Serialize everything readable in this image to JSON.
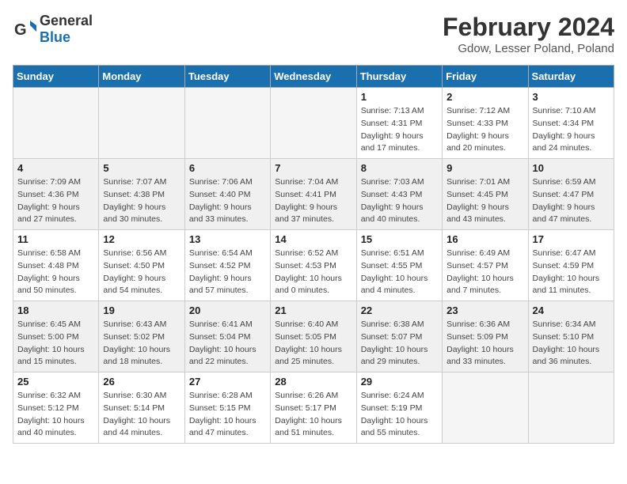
{
  "header": {
    "logo_line1": "General",
    "logo_line2": "Blue",
    "month_title": "February 2024",
    "location": "Gdow, Lesser Poland, Poland"
  },
  "days_of_week": [
    "Sunday",
    "Monday",
    "Tuesday",
    "Wednesday",
    "Thursday",
    "Friday",
    "Saturday"
  ],
  "weeks": [
    [
      {
        "day": "",
        "info": ""
      },
      {
        "day": "",
        "info": ""
      },
      {
        "day": "",
        "info": ""
      },
      {
        "day": "",
        "info": ""
      },
      {
        "day": "1",
        "info": "Sunrise: 7:13 AM\nSunset: 4:31 PM\nDaylight: 9 hours\nand 17 minutes."
      },
      {
        "day": "2",
        "info": "Sunrise: 7:12 AM\nSunset: 4:33 PM\nDaylight: 9 hours\nand 20 minutes."
      },
      {
        "day": "3",
        "info": "Sunrise: 7:10 AM\nSunset: 4:34 PM\nDaylight: 9 hours\nand 24 minutes."
      }
    ],
    [
      {
        "day": "4",
        "info": "Sunrise: 7:09 AM\nSunset: 4:36 PM\nDaylight: 9 hours\nand 27 minutes."
      },
      {
        "day": "5",
        "info": "Sunrise: 7:07 AM\nSunset: 4:38 PM\nDaylight: 9 hours\nand 30 minutes."
      },
      {
        "day": "6",
        "info": "Sunrise: 7:06 AM\nSunset: 4:40 PM\nDaylight: 9 hours\nand 33 minutes."
      },
      {
        "day": "7",
        "info": "Sunrise: 7:04 AM\nSunset: 4:41 PM\nDaylight: 9 hours\nand 37 minutes."
      },
      {
        "day": "8",
        "info": "Sunrise: 7:03 AM\nSunset: 4:43 PM\nDaylight: 9 hours\nand 40 minutes."
      },
      {
        "day": "9",
        "info": "Sunrise: 7:01 AM\nSunset: 4:45 PM\nDaylight: 9 hours\nand 43 minutes."
      },
      {
        "day": "10",
        "info": "Sunrise: 6:59 AM\nSunset: 4:47 PM\nDaylight: 9 hours\nand 47 minutes."
      }
    ],
    [
      {
        "day": "11",
        "info": "Sunrise: 6:58 AM\nSunset: 4:48 PM\nDaylight: 9 hours\nand 50 minutes."
      },
      {
        "day": "12",
        "info": "Sunrise: 6:56 AM\nSunset: 4:50 PM\nDaylight: 9 hours\nand 54 minutes."
      },
      {
        "day": "13",
        "info": "Sunrise: 6:54 AM\nSunset: 4:52 PM\nDaylight: 9 hours\nand 57 minutes."
      },
      {
        "day": "14",
        "info": "Sunrise: 6:52 AM\nSunset: 4:53 PM\nDaylight: 10 hours\nand 0 minutes."
      },
      {
        "day": "15",
        "info": "Sunrise: 6:51 AM\nSunset: 4:55 PM\nDaylight: 10 hours\nand 4 minutes."
      },
      {
        "day": "16",
        "info": "Sunrise: 6:49 AM\nSunset: 4:57 PM\nDaylight: 10 hours\nand 7 minutes."
      },
      {
        "day": "17",
        "info": "Sunrise: 6:47 AM\nSunset: 4:59 PM\nDaylight: 10 hours\nand 11 minutes."
      }
    ],
    [
      {
        "day": "18",
        "info": "Sunrise: 6:45 AM\nSunset: 5:00 PM\nDaylight: 10 hours\nand 15 minutes."
      },
      {
        "day": "19",
        "info": "Sunrise: 6:43 AM\nSunset: 5:02 PM\nDaylight: 10 hours\nand 18 minutes."
      },
      {
        "day": "20",
        "info": "Sunrise: 6:41 AM\nSunset: 5:04 PM\nDaylight: 10 hours\nand 22 minutes."
      },
      {
        "day": "21",
        "info": "Sunrise: 6:40 AM\nSunset: 5:05 PM\nDaylight: 10 hours\nand 25 minutes."
      },
      {
        "day": "22",
        "info": "Sunrise: 6:38 AM\nSunset: 5:07 PM\nDaylight: 10 hours\nand 29 minutes."
      },
      {
        "day": "23",
        "info": "Sunrise: 6:36 AM\nSunset: 5:09 PM\nDaylight: 10 hours\nand 33 minutes."
      },
      {
        "day": "24",
        "info": "Sunrise: 6:34 AM\nSunset: 5:10 PM\nDaylight: 10 hours\nand 36 minutes."
      }
    ],
    [
      {
        "day": "25",
        "info": "Sunrise: 6:32 AM\nSunset: 5:12 PM\nDaylight: 10 hours\nand 40 minutes."
      },
      {
        "day": "26",
        "info": "Sunrise: 6:30 AM\nSunset: 5:14 PM\nDaylight: 10 hours\nand 44 minutes."
      },
      {
        "day": "27",
        "info": "Sunrise: 6:28 AM\nSunset: 5:15 PM\nDaylight: 10 hours\nand 47 minutes."
      },
      {
        "day": "28",
        "info": "Sunrise: 6:26 AM\nSunset: 5:17 PM\nDaylight: 10 hours\nand 51 minutes."
      },
      {
        "day": "29",
        "info": "Sunrise: 6:24 AM\nSunset: 5:19 PM\nDaylight: 10 hours\nand 55 minutes."
      },
      {
        "day": "",
        "info": ""
      },
      {
        "day": "",
        "info": ""
      }
    ]
  ]
}
